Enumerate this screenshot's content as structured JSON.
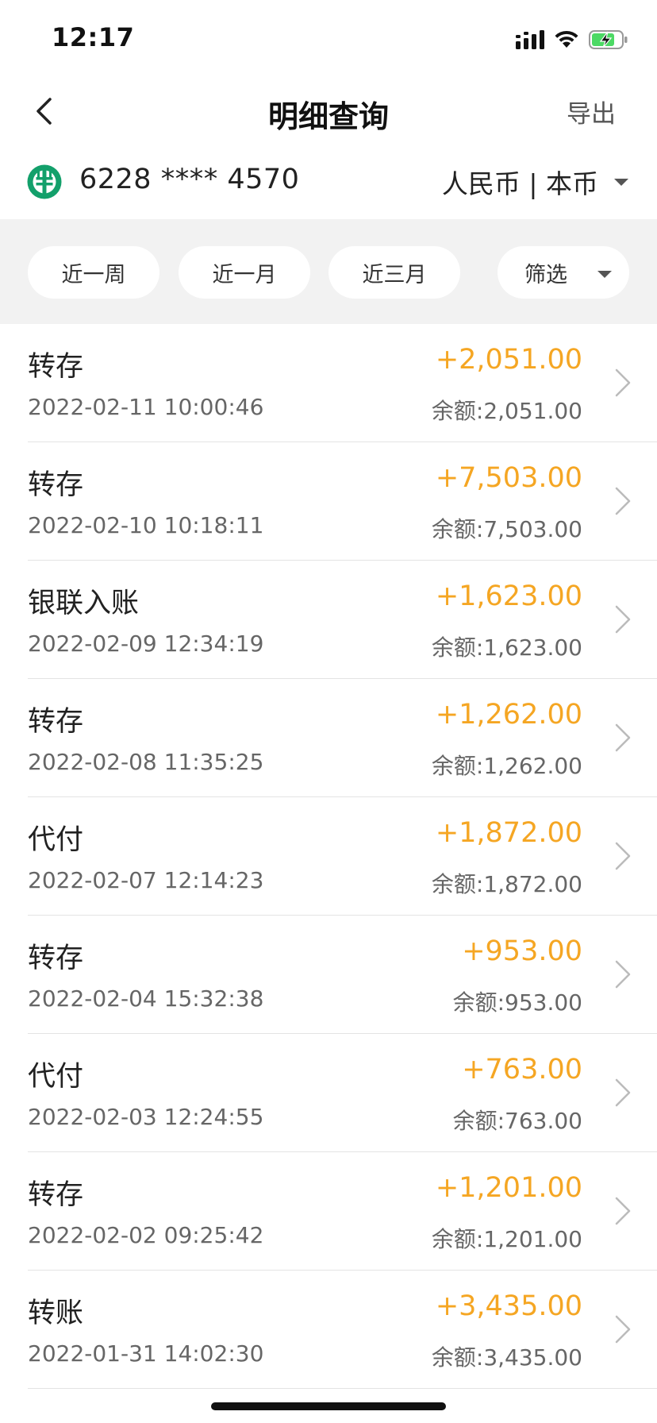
{
  "status_bar": {
    "time": "12:17",
    "icons": [
      "signal-icon",
      "wifi-icon",
      "battery-charging-icon"
    ]
  },
  "nav": {
    "title": "明细查询",
    "export_label": "导出",
    "back_icon": "chevron-left-icon"
  },
  "account": {
    "number": "6228 **** 4570",
    "currency_label": "人民币 | 本币",
    "logo": "abc-bank-logo"
  },
  "filters": {
    "week_label": "近一周",
    "month_label": "近一月",
    "three_months_label": "近三月",
    "filter_label": "筛选"
  },
  "transactions": [
    {
      "type": "转存",
      "time": "2022-02-11 10:00:46",
      "amount": "+2,051.00",
      "balance_label": "余额:",
      "balance": "2,051.00"
    },
    {
      "type": "转存",
      "time": "2022-02-10 10:18:11",
      "amount": "+7,503.00",
      "balance_label": "余额:",
      "balance": "7,503.00"
    },
    {
      "type": "银联入账",
      "time": "2022-02-09 12:34:19",
      "amount": "+1,623.00",
      "balance_label": "余额:",
      "balance": "1,623.00"
    },
    {
      "type": "转存",
      "time": "2022-02-08 11:35:25",
      "amount": "+1,262.00",
      "balance_label": "余额:",
      "balance": "1,262.00"
    },
    {
      "type": "代付",
      "time": "2022-02-07 12:14:23",
      "amount": "+1,872.00",
      "balance_label": "余额:",
      "balance": "1,872.00"
    },
    {
      "type": "转存",
      "time": "2022-02-04 15:32:38",
      "amount": "+953.00",
      "balance_label": "余额:",
      "balance": "953.00"
    },
    {
      "type": "代付",
      "time": "2022-02-03 12:24:55",
      "amount": "+763.00",
      "balance_label": "余额:",
      "balance": "763.00"
    },
    {
      "type": "转存",
      "time": "2022-02-02 09:25:42",
      "amount": "+1,201.00",
      "balance_label": "余额:",
      "balance": "1,201.00"
    },
    {
      "type": "转账",
      "time": "2022-01-31 14:02:30",
      "amount": "+3,435.00",
      "balance_label": "余额:",
      "balance": "3,435.00"
    }
  ],
  "colors": {
    "amount": "#f5a623",
    "brand_green": "#13a06b",
    "filter_band": "#f2f2f2",
    "battery_green": "#4cd964"
  }
}
